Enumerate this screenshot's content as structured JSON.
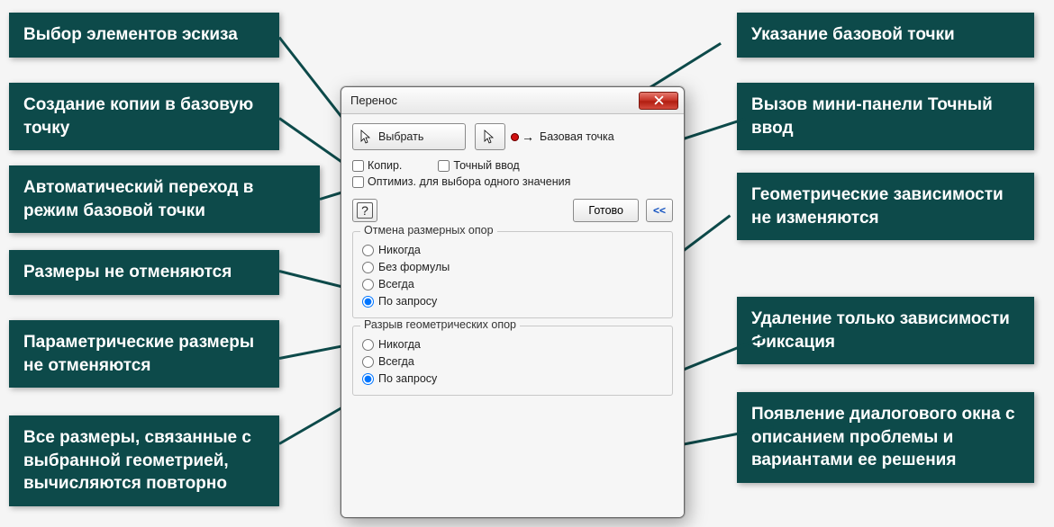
{
  "callouts": {
    "left1": "Выбор элементов эскиза",
    "left2": "Создание копии в базовую точку",
    "left3": "Автоматический переход в режим базовой точки",
    "left4": "Размеры не отменяются",
    "left5": "Параметрические размеры не отменяются",
    "left6": "Все  размеры, связанные с выбранной геометрией, вычисляются повторно",
    "right1": "Указание базовой точки",
    "right2": "Вызов мини-панели Точный ввод",
    "right3": "Геометрические зависимости не изменяются",
    "right4": "Удаление только зависимости Фиксация",
    "right5": "Появление диалогового окна с описанием проблемы и вариантами ее решения"
  },
  "dialog": {
    "title": "Перенос",
    "select_label": "Выбрать",
    "basepoint_label": "Базовая точка",
    "copy_label": "Копир.",
    "precise_label": "Точный ввод",
    "optimize_label": "Оптимиз. для выбора одного значения",
    "done_label": "Готово",
    "collapse_label": "<<",
    "help_label": "?",
    "group1": {
      "title": "Отмена размерных опор",
      "opt1": "Никогда",
      "opt2": "Без формулы",
      "opt3": "Всегда",
      "opt4": "По запросу"
    },
    "group2": {
      "title": "Разрыв геометрических опор",
      "opt1": "Никогда",
      "opt2": "Всегда",
      "opt3": "По запросу"
    }
  }
}
